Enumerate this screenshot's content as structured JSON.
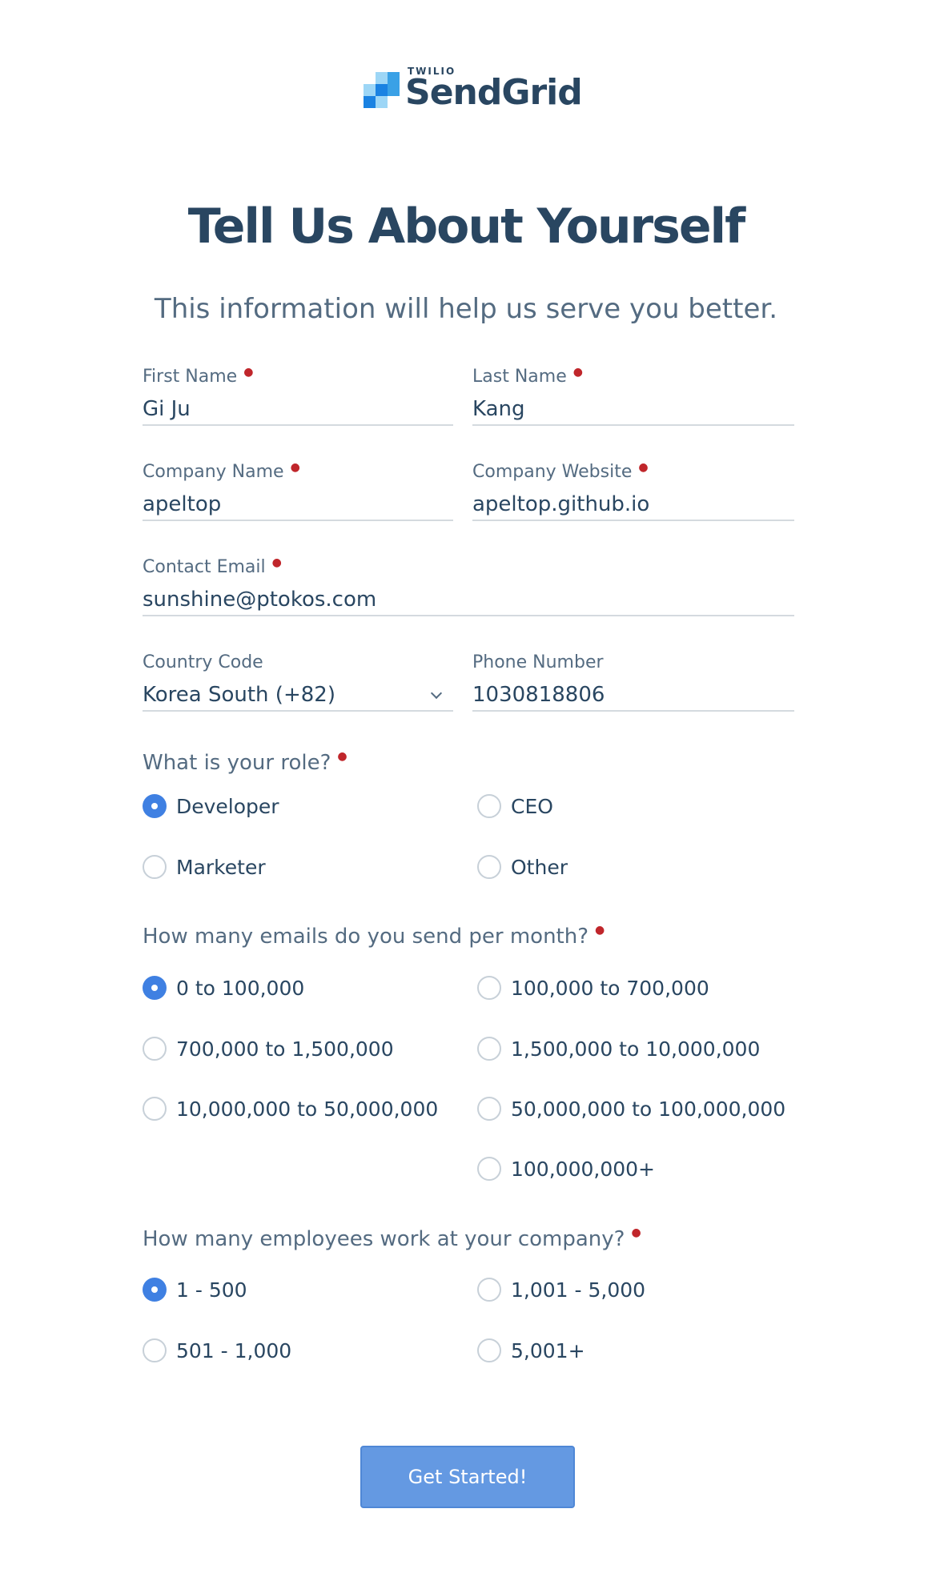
{
  "brand": {
    "small": "TWILIO",
    "name": "SendGrid"
  },
  "header": {
    "title": "Tell Us About Yourself",
    "subtitle": "This information will help us serve you better."
  },
  "fields": {
    "first_name": {
      "label": "First Name",
      "value": "Gi Ju"
    },
    "last_name": {
      "label": "Last Name",
      "value": "Kang"
    },
    "company_name": {
      "label": "Company Name",
      "value": "apeltop"
    },
    "company_website": {
      "label": "Company Website",
      "value": "apeltop.github.io"
    },
    "contact_email": {
      "label": "Contact Email",
      "value": "sunshine@ptokos.com"
    },
    "country_code": {
      "label": "Country Code",
      "value": "Korea South (+82)"
    },
    "phone_number": {
      "label": "Phone Number",
      "value": "1030818806"
    }
  },
  "role": {
    "question": "What is your role?",
    "options": [
      "Developer",
      "CEO",
      "Marketer",
      "Other"
    ],
    "selected": "Developer"
  },
  "emails": {
    "question": "How many emails do you send per month?",
    "options": [
      "0 to 100,000",
      "100,000 to 700,000",
      "700,000 to 1,500,000",
      "1,500,000 to 10,000,000",
      "10,000,000 to 50,000,000",
      "50,000,000 to 100,000,000",
      "100,000,000+"
    ],
    "selected": "0 to 100,000"
  },
  "employees": {
    "question": "How many employees work at your company?",
    "options": [
      "1 - 500",
      "1,001 - 5,000",
      "501 - 1,000",
      "5,001+"
    ],
    "selected": "1 - 500"
  },
  "submit_label": "Get Started!",
  "colors": {
    "primary": "#3f80e2",
    "button": "#6499e2",
    "text": "#294661",
    "muted": "#546b81",
    "required": "#c0262b"
  }
}
